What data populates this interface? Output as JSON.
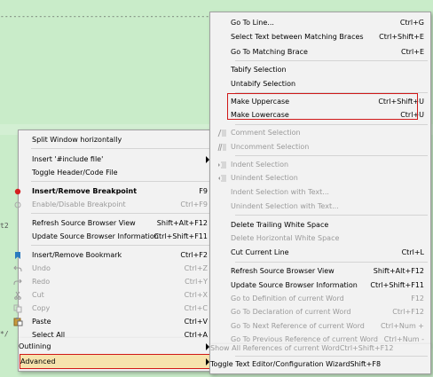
{
  "background": {
    "code_line_1": "----------------------------------------------------*/",
    "code_line_2": "t2",
    "code_line_3": "*/"
  },
  "colors": {
    "editor_background": "#c9ecc9",
    "menu_background": "#f2f2f2",
    "highlight_box": "#d01818",
    "advanced_highlight": "#f6e3ad",
    "disabled_text": "#9a9a9a"
  },
  "left_menu": {
    "items": [
      {
        "label": "Split Window horizontally",
        "shortcut": "",
        "icon": "",
        "disabled": false
      },
      {
        "label": "Insert '#include file'",
        "shortcut": "",
        "icon": "",
        "disabled": false,
        "submenu": true
      },
      {
        "label": "Toggle Header/Code File",
        "shortcut": "",
        "icon": "",
        "disabled": false
      },
      {
        "label": "Insert/Remove Breakpoint",
        "shortcut": "F9",
        "icon": "breakpoint-icon",
        "disabled": false,
        "bold": true
      },
      {
        "label": "Enable/Disable Breakpoint",
        "shortcut": "Ctrl+F9",
        "icon": "breakpoint-hollow-icon",
        "disabled": true
      },
      {
        "label": "Refresh Source Browser View",
        "shortcut": "Shift+Alt+F12",
        "icon": "",
        "disabled": false
      },
      {
        "label": "Update Source Browser Information",
        "shortcut": "Ctrl+Shift+F11",
        "icon": "",
        "disabled": false
      },
      {
        "label": "Insert/Remove Bookmark",
        "shortcut": "Ctrl+F2",
        "icon": "bookmark-icon",
        "disabled": false
      },
      {
        "label": "Undo",
        "shortcut": "Ctrl+Z",
        "icon": "undo-icon",
        "disabled": true
      },
      {
        "label": "Redo",
        "shortcut": "Ctrl+Y",
        "icon": "redo-icon",
        "disabled": true
      },
      {
        "label": "Cut",
        "shortcut": "Ctrl+X",
        "icon": "cut-icon",
        "disabled": true
      },
      {
        "label": "Copy",
        "shortcut": "Ctrl+C",
        "icon": "copy-icon",
        "disabled": true
      },
      {
        "label": "Paste",
        "shortcut": "Ctrl+V",
        "icon": "paste-icon",
        "disabled": false
      },
      {
        "label": "Select All",
        "shortcut": "Ctrl+A",
        "icon": "",
        "disabled": false
      },
      {
        "label": "Outlining",
        "shortcut": "",
        "icon": "",
        "disabled": false,
        "submenu": true
      },
      {
        "label": "Advanced",
        "shortcut": "",
        "icon": "",
        "disabled": false,
        "submenu": true,
        "highlighted": true
      }
    ]
  },
  "right_menu": {
    "items": [
      {
        "label": "Go To Line...",
        "shortcut": "Ctrl+G",
        "icon": "",
        "disabled": false
      },
      {
        "label": "Select Text between Matching Braces",
        "shortcut": "Ctrl+Shift+E",
        "icon": "",
        "disabled": false
      },
      {
        "label": "Go To Matching Brace",
        "shortcut": "Ctrl+E",
        "icon": "",
        "disabled": false
      },
      {
        "label": "Tabify Selection",
        "shortcut": "",
        "icon": "",
        "disabled": false
      },
      {
        "label": "Untabify Selection",
        "shortcut": "",
        "icon": "",
        "disabled": false
      },
      {
        "label": "Make Uppercase",
        "shortcut": "Ctrl+Shift+U",
        "icon": "",
        "disabled": false,
        "highlighted": true
      },
      {
        "label": "Make Lowercase",
        "shortcut": "Ctrl+U",
        "icon": "",
        "disabled": false,
        "highlighted": true
      },
      {
        "label": "Comment Selection",
        "shortcut": "",
        "icon": "comment-icon",
        "disabled": true
      },
      {
        "label": "Uncomment Selection",
        "shortcut": "",
        "icon": "uncomment-icon",
        "disabled": true
      },
      {
        "label": "Indent Selection",
        "shortcut": "",
        "icon": "indent-icon",
        "disabled": true
      },
      {
        "label": "Unindent Selection",
        "shortcut": "",
        "icon": "unindent-icon",
        "disabled": true
      },
      {
        "label": "Indent Selection with Text...",
        "shortcut": "",
        "icon": "",
        "disabled": true
      },
      {
        "label": "Unindent Selection with Text...",
        "shortcut": "",
        "icon": "",
        "disabled": true
      },
      {
        "label": "Delete Trailing White Space",
        "shortcut": "",
        "icon": "",
        "disabled": false
      },
      {
        "label": "Delete Horizontal White Space",
        "shortcut": "",
        "icon": "",
        "disabled": true
      },
      {
        "label": "Cut Current Line",
        "shortcut": "Ctrl+L",
        "icon": "",
        "disabled": false
      },
      {
        "label": "Refresh Source Browser View",
        "shortcut": "Shift+Alt+F12",
        "icon": "",
        "disabled": false
      },
      {
        "label": "Update Source Browser Information",
        "shortcut": "Ctrl+Shift+F11",
        "icon": "",
        "disabled": false
      },
      {
        "label": "Go to Definition of current Word",
        "shortcut": "F12",
        "icon": "",
        "disabled": true
      },
      {
        "label": "Go To Declaration of current Word",
        "shortcut": "Ctrl+F12",
        "icon": "",
        "disabled": true
      },
      {
        "label": "Go To Next Reference of current Word",
        "shortcut": "Ctrl+Num +",
        "icon": "",
        "disabled": true
      },
      {
        "label": "Go To Previous Reference of current Word",
        "shortcut": "Ctrl+Num -",
        "icon": "",
        "disabled": true
      },
      {
        "label": "Show All References of current Word",
        "shortcut": "Ctrl+Shift+F12",
        "icon": "",
        "disabled": true
      },
      {
        "label": "Toggle Text Editor/Configuration Wizard",
        "shortcut": "Shift+F8",
        "icon": "",
        "disabled": false
      }
    ]
  }
}
